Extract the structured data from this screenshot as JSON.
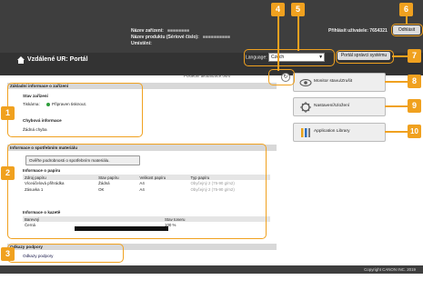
{
  "header": {
    "device_name_label": "Název zařízení:",
    "product_name_label": "Název produktu (Sériové číslo):",
    "location_label": "Umístění:",
    "user_label": "Přihlásit uživatele:",
    "user_value": "7654321",
    "logout_label": "Odhlásit",
    "portal_title": "Vzdálené UR: Portál",
    "language_label": "Language:",
    "language_value": "Czech",
    "admin_button": "Portál správci systému"
  },
  "main": {
    "last_update": "Poslední aktualizace:06/0",
    "basic_info": {
      "title": "Základní informace o zařízení",
      "device_status_label": "Stav zařízení",
      "printer_label": "Tiskárna:",
      "printer_status": "Připraven tisknout.",
      "error_label": "Chybová informace",
      "error_value": "Žádná chyba"
    },
    "consumables": {
      "title": "Informace o spotřebním materiálu",
      "check_button": "Ověřte podrobnosti o spotřebním materiálu.",
      "paper_info_title": "Informace o papíru",
      "paper_headers": [
        "Zdroj papíru",
        "Stav papíru",
        "Velikost papíru",
        "Typ papíru"
      ],
      "paper_rows": [
        [
          "Víceúčelová přihrádka",
          "Žádná",
          "A4",
          "Obyčejný 2 (75-90 g/m2)"
        ],
        [
          "Zásuvka 1",
          "OK",
          "A4",
          "Obyčejný 2 (75-90 g/m2)"
        ]
      ],
      "cartridge_title": "Informace o kazetě",
      "cartridge_headers": [
        "Barevný",
        "Stav toneru"
      ],
      "cartridge_row": {
        "color": "Černá",
        "percent": "100 %"
      },
      "toner_level": 1.0
    },
    "support": {
      "title": "Odkazy podpory",
      "link": "Odkazy podpory"
    }
  },
  "sidebar": {
    "monitor": "Monitor stavu/Zrušit",
    "settings": "Nastavení/Uložení",
    "library": "Application Library"
  },
  "footer": {
    "copyright": "Copyright CANON INC. 2019"
  },
  "callouts": [
    "1",
    "2",
    "3",
    "4",
    "5",
    "6",
    "7",
    "8",
    "9",
    "10"
  ],
  "colors": {
    "callout": "#f0a11f",
    "header": "#3e3e3e"
  }
}
